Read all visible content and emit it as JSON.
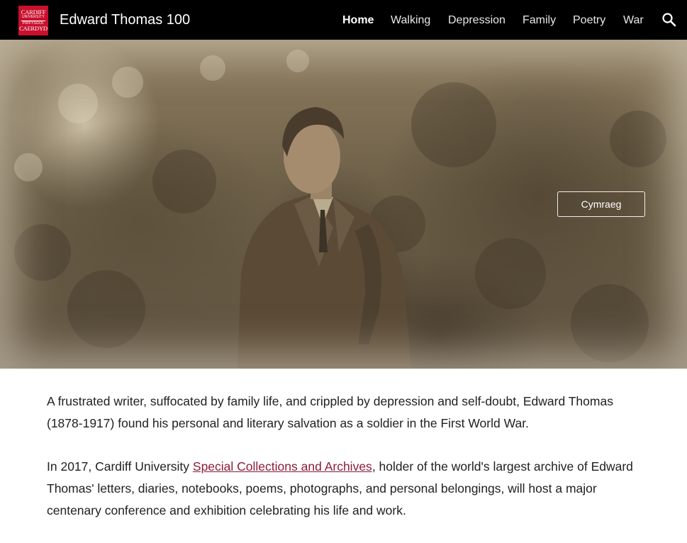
{
  "header": {
    "logo": {
      "line1": "CARDIFF",
      "line2": "UNIVERSITY",
      "line3": "PRIFYSGOL",
      "line4": "CAERDYD"
    },
    "site_title": "Edward Thomas 100",
    "nav": [
      {
        "label": "Home",
        "active": true
      },
      {
        "label": "Walking",
        "active": false
      },
      {
        "label": "Depression",
        "active": false
      },
      {
        "label": "Family",
        "active": false
      },
      {
        "label": "Poetry",
        "active": false
      },
      {
        "label": "War",
        "active": false
      }
    ],
    "search_icon": "search-icon"
  },
  "hero": {
    "language_button": "Cymraeg"
  },
  "content": {
    "paragraph1": "A frustrated writer, suffocated by family life, and crippled by depression and self-doubt, Edward Thomas (1878-1917) found his personal and literary salvation as a soldier in the First World War.",
    "paragraph2_before": "In 2017, Cardiff University ",
    "paragraph2_link": "Special Collections and Archives",
    "paragraph2_after": ", holder of the world's largest archive of Edward Thomas' letters, diaries, notebooks, poems, photographs, and personal belongings, will host a major centenary conference and exhibition celebrating his life and work."
  },
  "colors": {
    "header_bg": "#000000",
    "logo_red": "#c8102e",
    "link": "#8e1c3b",
    "text": "#212121"
  }
}
